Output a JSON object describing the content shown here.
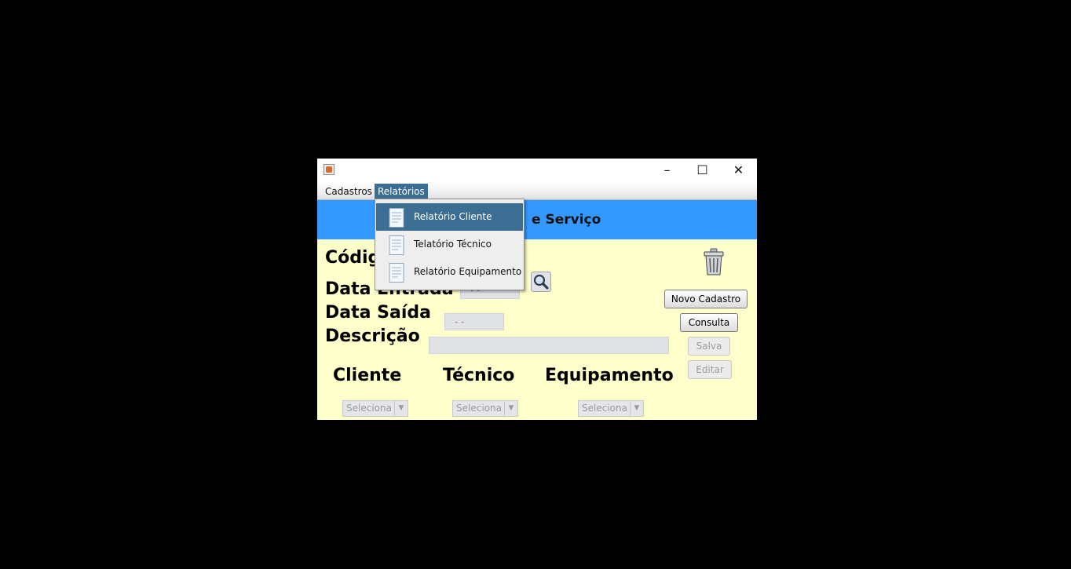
{
  "window": {
    "minimize": "–",
    "maximize": "☐",
    "close": "✕"
  },
  "menubar": {
    "items": [
      "Cadastros",
      "Relatórios"
    ]
  },
  "header": {
    "title": "e Serviço"
  },
  "form": {
    "codigo_label": "Códig",
    "data_entrada_label": "Data Entrada",
    "data_saida_label": "Data Saída",
    "descricao_label": "Descrição",
    "data_entrada_value": "- -",
    "data_saida_value": "- -",
    "cliente_label": "Cliente",
    "tecnico_label": "Técnico",
    "equipamento_label": "Equipamento",
    "combo_placeholder": "Seleciona"
  },
  "buttons": {
    "novo": "Novo Cadastro",
    "consulta": "Consulta",
    "salva": "Salva",
    "editar": "Editar"
  },
  "relatorios_menu": {
    "items": [
      "Relatório Cliente",
      "Telatório Técnico",
      "Relatório Equipamento"
    ]
  },
  "icons": {
    "search": "search-icon",
    "trash": "trash-icon",
    "report": "report-document-icon",
    "app": "java-app-icon"
  },
  "colors": {
    "header": "#3399ff",
    "content_bg": "#ffffcc",
    "menu_selected": "#3c6d92"
  }
}
